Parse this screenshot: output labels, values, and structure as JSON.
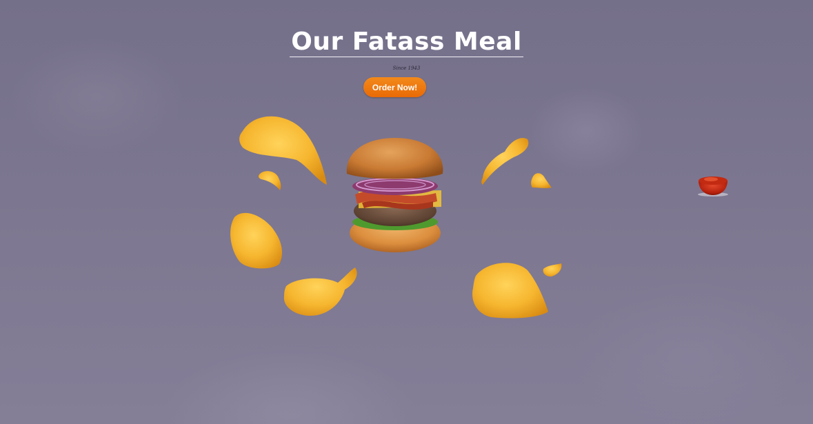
{
  "hero": {
    "title": "Our Fatass Meal",
    "tagline": "Since 1943",
    "cta_label": "Order Now!"
  },
  "colors": {
    "accent": "#ee7b0f",
    "background": "#7c7690",
    "title": "#ffffff"
  },
  "icons": {
    "burger": "burger-icon",
    "chip": "potato-chip-icon",
    "sauce": "ketchup-bowl-icon"
  }
}
